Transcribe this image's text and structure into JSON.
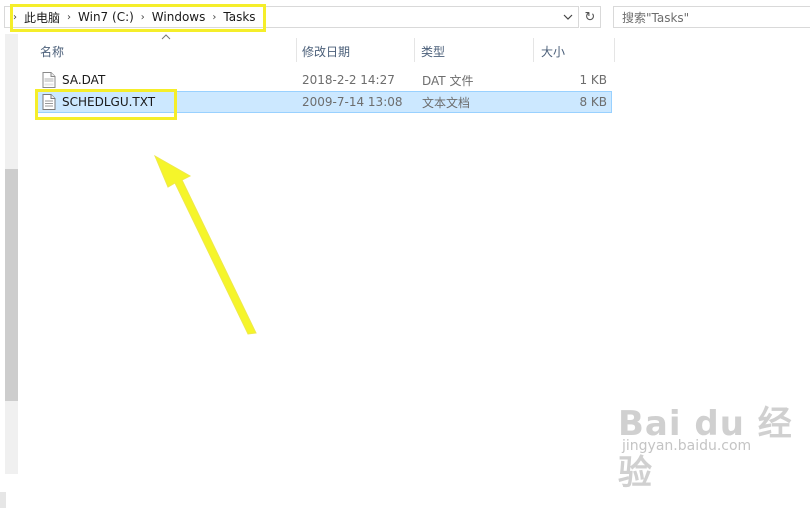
{
  "address_bar": {
    "crumbs": [
      "此电脑",
      "Win7 (C:)",
      "Windows",
      "Tasks"
    ]
  },
  "search": {
    "placeholder": "搜索\"Tasks\""
  },
  "columns": {
    "name": "名称",
    "modified": "修改日期",
    "type": "类型",
    "size": "大小"
  },
  "files": [
    {
      "name": "SA.DAT",
      "modified": "2018-2-2 14:27",
      "type": "DAT 文件",
      "size": "1 KB",
      "icon": "dat-file-icon"
    },
    {
      "name": "SCHEDLGU.TXT",
      "modified": "2009-7-14 13:08",
      "type": "文本文档",
      "size": "8 KB",
      "icon": "text-file-icon",
      "selected": true
    }
  ],
  "watermark": {
    "brand": "Bai du 经验",
    "site": "jingyan.baidu.com"
  },
  "colors": {
    "highlight": "#f5ee2a",
    "selection": "#cce8ff",
    "header_text": "#4c607a"
  }
}
